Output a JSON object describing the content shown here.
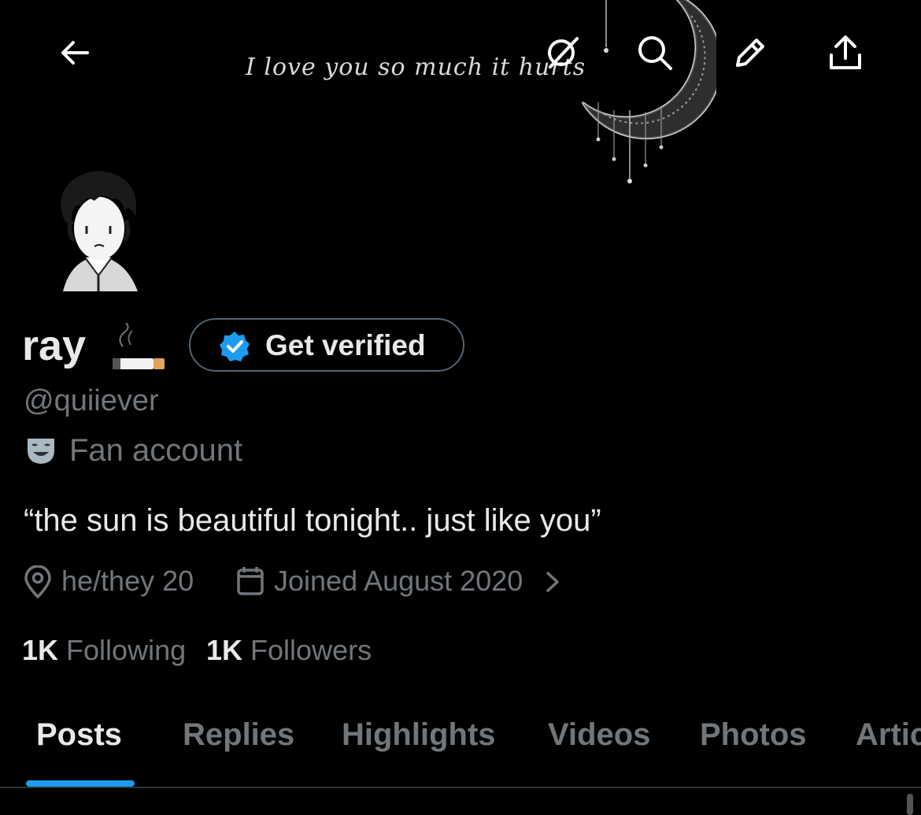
{
  "banner": {
    "quote": "I love you so much it hurts"
  },
  "header": {
    "back_icon": "arrow-left-icon",
    "grok_icon": "grok-icon",
    "search_icon": "search-icon",
    "edit_icon": "pencil-icon",
    "share_icon": "share-icon"
  },
  "profile": {
    "display_name": "ray",
    "name_emoji": "cigarette-emoji",
    "verify_button_label": "Get verified",
    "verify_badge_color": "#1d9bf0",
    "handle": "@quiiever",
    "category_icon": "theater-masks-icon",
    "category": "Fan account",
    "bio": "“the sun is beautiful tonight.. just like you”",
    "location": "he/they 20",
    "joined": "Joined August 2020"
  },
  "stats": {
    "following_count": "1K",
    "following_label": "Following",
    "followers_count": "1K",
    "followers_label": "Followers"
  },
  "tabs": [
    {
      "label": "Posts",
      "active": true
    },
    {
      "label": "Replies",
      "active": false
    },
    {
      "label": "Highlights",
      "active": false
    },
    {
      "label": "Videos",
      "active": false
    },
    {
      "label": "Photos",
      "active": false
    },
    {
      "label": "Artic",
      "active": false
    }
  ],
  "colors": {
    "background": "#000000",
    "primary_text": "#e7e9ea",
    "secondary_text": "#71767b",
    "accent": "#1d9bf0"
  }
}
